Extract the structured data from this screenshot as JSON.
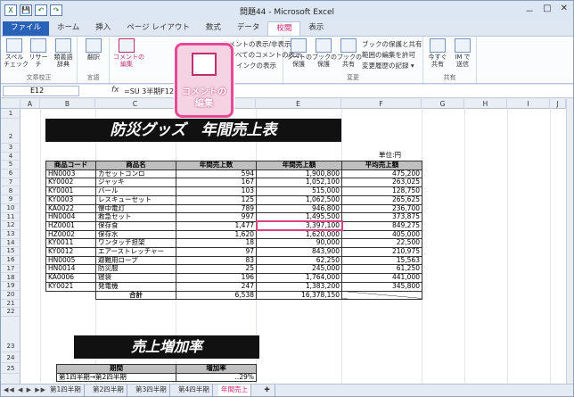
{
  "title": "問題44 - Microsoft Excel",
  "qat": [
    "X",
    "💾",
    "↶",
    "↷"
  ],
  "tabs": [
    "ファイル",
    "ホーム",
    "挿入",
    "ページ レイアウト",
    "数式",
    "データ",
    "校閲",
    "表示"
  ],
  "ribbon": {
    "proof_btns": [
      "スペル\nチェック",
      "リサーチ",
      "類義語\n辞典"
    ],
    "proof_label": "文章校正",
    "lang_btn": "翻訳",
    "lang_label": "言語",
    "comment_btn": "コメントの\n編集",
    "comment_menu": [
      "コメントの表示/非表示",
      "すべてのコメントの表示",
      "インクの表示"
    ],
    "change_btns": [
      "シートの\n保護",
      "ブックの\n保護",
      "ブックの\n共有"
    ],
    "change_menu": [
      "ブックの保護と共有",
      "範囲の編集を許可",
      "変更履歴の記録 ▾"
    ],
    "change_label": "変更",
    "share_btns": [
      "今すぐ\n共有",
      "IM で\n送信"
    ],
    "share_label": "共有"
  },
  "namebox": "E12",
  "fx": "fx",
  "formula": "=SU                    3半期F12)",
  "columns": [
    "A",
    "B",
    "C",
    "D",
    "E",
    "F",
    "G",
    "H",
    "I",
    "J"
  ],
  "rows": [
    "1",
    "2",
    "3",
    "4",
    "5",
    "6",
    "7",
    "8",
    "9",
    "10",
    "11",
    "12",
    "13",
    "14",
    "15",
    "16",
    "17",
    "18",
    "19",
    "20",
    "21",
    "22",
    "23",
    "24",
    "25"
  ],
  "banner1": "防災グッズ　年間売上表",
  "banner2": "売上増加率",
  "unit": "単位:円",
  "table": {
    "headers": [
      "商品コード",
      "商品名",
      "年間売上数",
      "年間売上額",
      "平均売上額"
    ],
    "rows": [
      [
        "HN0003",
        "カセットコンロ",
        "594",
        "1,900,800",
        "475,200"
      ],
      [
        "KY0002",
        "ジャッキ",
        "167",
        "1,052,100",
        "263,025"
      ],
      [
        "KY0001",
        "バール",
        "103",
        "515,000",
        "128,750"
      ],
      [
        "KY0003",
        "レスキューセット",
        "125",
        "1,062,500",
        "265,625"
      ],
      [
        "KA0022",
        "懐中電灯",
        "789",
        "946,800",
        "236,700"
      ],
      [
        "HN0004",
        "救急セット",
        "997",
        "1,495,500",
        "373,875"
      ],
      [
        "HZ0001",
        "保存食",
        "1,477",
        "3,397,100",
        "849,275"
      ],
      [
        "HZ0002",
        "保存水",
        "1,620",
        "1,620,000",
        "405,000"
      ],
      [
        "KY0011",
        "ワンタッチ担架",
        "18",
        "90,000",
        "22,500"
      ],
      [
        "KY0012",
        "エアーストレッチャー",
        "97",
        "843,900",
        "210,975"
      ],
      [
        "HN0005",
        "避難用ロープ",
        "83",
        "62,250",
        "15,563"
      ],
      [
        "HN0014",
        "防災服",
        "25",
        "245,000",
        "61,250"
      ],
      [
        "KA0006",
        "寝袋",
        "196",
        "1,764,000",
        "441,000"
      ],
      [
        "KY0021",
        "発電機",
        "247",
        "1,383,200",
        "345,800"
      ]
    ],
    "total_label": "合計",
    "total_qty": "6,538",
    "total_sales": "16,378,150"
  },
  "table2": {
    "headers": [
      "期間",
      "増加率"
    ],
    "row": "第1四半期→第2四半期",
    "val": "..29%"
  },
  "sheets": [
    "第1四半期",
    "第2四半期",
    "第3四半期",
    "第4四半期",
    "年間売上"
  ],
  "nav_arrows": "◀◀ ◀ ▶ ▶▶",
  "callout_text": "コメントの\n編集",
  "winctl": [
    "－",
    "□",
    "✕"
  ]
}
